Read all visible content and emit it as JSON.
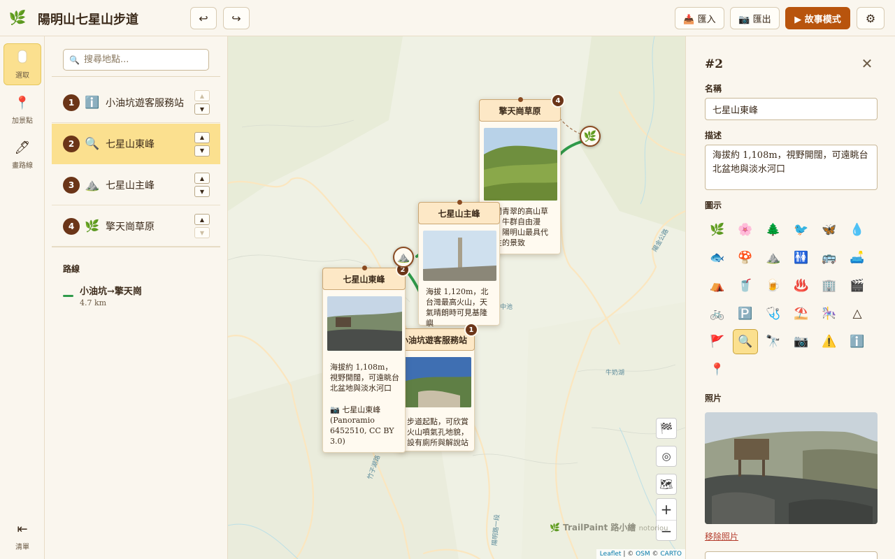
{
  "header": {
    "logo_icon": "leaf-icon",
    "title": "陽明山七星山步道",
    "undo_icon": "↩",
    "redo_icon": "↪",
    "import_label": "📥 匯入",
    "export_label": "📷 匯出",
    "story_label": "▶ 故事模式",
    "settings_icon": "⚙"
  },
  "tools": [
    {
      "name": "select",
      "label": "選取",
      "icon": "▯",
      "active": true
    },
    {
      "name": "add-place",
      "label": "加景點",
      "icon": "📍",
      "active": false
    },
    {
      "name": "draw-route",
      "label": "畫路線",
      "icon": "🖊",
      "active": false
    }
  ],
  "collapse": {
    "icon": "⇤",
    "label": "清單"
  },
  "list": {
    "search_placeholder": "搜尋地點...",
    "places": [
      {
        "num": "1",
        "icon": "ℹ️",
        "name": "小油坑遊客服務站",
        "selected": false
      },
      {
        "num": "2",
        "icon": "🔍",
        "name": "七星山東峰",
        "selected": true
      },
      {
        "num": "3",
        "icon": "⛰️",
        "name": "七星山主峰",
        "selected": false
      },
      {
        "num": "4",
        "icon": "🌿",
        "name": "擎天崗草原",
        "selected": false
      }
    ],
    "up_arrow": "▲",
    "down_arrow": "▼",
    "routes_heading": "路線",
    "routes": [
      {
        "name": "小油坑→擎天崗",
        "distance": "4.7 km",
        "color": "#2f9a4a"
      }
    ]
  },
  "map": {
    "cards": {
      "c4": {
        "title": "擎天崗草原",
        "desc": "廣闊青翠的高山草原，牛群自由漫步，陽明山最具代表性的景致",
        "badge": "4"
      },
      "c3": {
        "title": "七星山主峰",
        "desc": "海拔 1,120m，北台灣最高火山，天氣晴朗時可見基隆嶼",
        "badge": "3"
      },
      "c1": {
        "title": "小油坑遊客服務站",
        "desc": "步道起點，可欣賞火山噴氣孔地貌，設有廁所與解說站",
        "badge": "1"
      },
      "c2": {
        "title": "七星山東峰",
        "desc": "海拔約 1,108m，視野開闊，可遠眺台北盆地與淡水河口",
        "credit": "📷 七星山東峰 (Panoramio 6452510, CC BY 3.0)",
        "badge": "2"
      }
    },
    "labels": {
      "l1": "中池",
      "l2": "牛奶湖",
      "l3": "竹子湖路",
      "l4": "陽明路一段",
      "l5": "陽金公路"
    },
    "controls": {
      "finish": "🏁",
      "locate": "◎",
      "layers": "🗺",
      "zoom_in": "+",
      "zoom_out": "−"
    },
    "watermark": "🌿 TrailPaint 路小繪",
    "watermark_extra": "notoriou",
    "attribution": {
      "leaflet": "Leaflet",
      "sep1": " | © ",
      "osm": "OSM",
      "sep2": " © ",
      "carto": "CARTO"
    }
  },
  "inspector": {
    "heading": "#2",
    "close_icon": "✕",
    "name_label": "名稱",
    "name_value": "七星山東峰",
    "desc_label": "描述",
    "desc_value": "海拔約 1,108m，視野開闊，可遠眺台北盆地與淡水河口",
    "icon_label": "圖示",
    "icons": [
      {
        "name": "leaf",
        "glyph": "🌿"
      },
      {
        "name": "flower",
        "glyph": "🌸"
      },
      {
        "name": "tree",
        "glyph": "🌲"
      },
      {
        "name": "bird",
        "glyph": "🐦"
      },
      {
        "name": "butterfly",
        "glyph": "🦋"
      },
      {
        "name": "droplet",
        "glyph": "💧"
      },
      {
        "name": "fish",
        "glyph": "🐟"
      },
      {
        "name": "mushroom",
        "glyph": "🍄"
      },
      {
        "name": "mountain",
        "glyph": "⛰️"
      },
      {
        "name": "restroom",
        "glyph": "🚻"
      },
      {
        "name": "bus",
        "glyph": "🚌"
      },
      {
        "name": "sofa",
        "glyph": "🛋️"
      },
      {
        "name": "tent",
        "glyph": "⛺"
      },
      {
        "name": "drink",
        "glyph": "🥤"
      },
      {
        "name": "beer",
        "glyph": "🍺"
      },
      {
        "name": "hot-spring",
        "glyph": "♨️"
      },
      {
        "name": "building",
        "glyph": "🏢"
      },
      {
        "name": "clapper",
        "glyph": "🎬"
      },
      {
        "name": "bicycle",
        "glyph": "🚲"
      },
      {
        "name": "parking",
        "glyph": "🅿️"
      },
      {
        "name": "stethoscope",
        "glyph": "🩺"
      },
      {
        "name": "beach",
        "glyph": "⛱️"
      },
      {
        "name": "carousel",
        "glyph": "🎠"
      },
      {
        "name": "triangle",
        "glyph": "△"
      },
      {
        "name": "flag",
        "glyph": "🚩"
      },
      {
        "name": "magnifier",
        "glyph": "🔍",
        "active": true
      },
      {
        "name": "telescope",
        "glyph": "🔭"
      },
      {
        "name": "camera",
        "glyph": "📷"
      },
      {
        "name": "warning",
        "glyph": "⚠️"
      },
      {
        "name": "info",
        "glyph": "ℹ️"
      },
      {
        "name": "pin",
        "glyph": "📍"
      }
    ],
    "photo_label": "照片",
    "remove_photo": "移除照片"
  },
  "colors": {
    "accent": "#b8540d",
    "selected_bg": "#fbe08f",
    "badge": "#6b3518",
    "route": "#2f9a4a"
  }
}
